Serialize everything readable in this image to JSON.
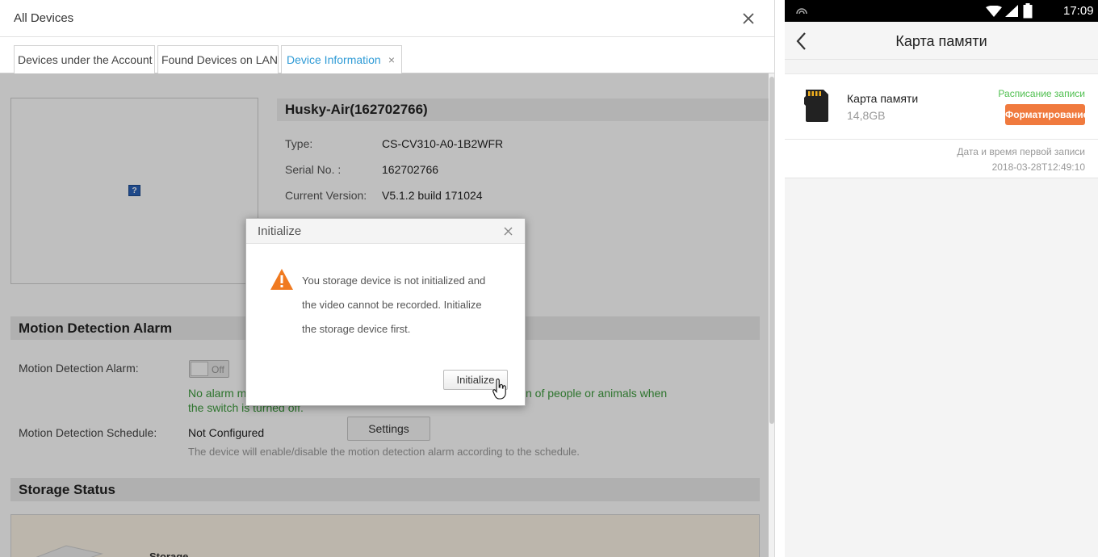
{
  "window": {
    "title": "All Devices",
    "tabs": [
      {
        "label": "Devices under the Account"
      },
      {
        "label": "Found Devices on LAN"
      },
      {
        "label": "Device Information",
        "close": "×"
      }
    ]
  },
  "device": {
    "name": "Husky-Air(162702766)",
    "type_label": "Type:",
    "type_value": "CS-CV310-A0-1B2WFR",
    "serial_label": "Serial No. :",
    "serial_value": "162702766",
    "version_label": "Current Version:",
    "version_value": "V5.1.2 build 171024",
    "image_placeholder": "?"
  },
  "motion": {
    "section_title": "Motion Detection Alarm",
    "alarm_label": "Motion Detection Alarm:",
    "toggle_state": "Off",
    "alarm_note_visible_1": "No alarm m",
    "alarm_note_visible_2": "n of people or animals when",
    "alarm_note_visible_3": "the switch is turned off.",
    "schedule_label": "Motion Detection Schedule:",
    "schedule_value": "Not Configured",
    "settings_button": "Settings",
    "schedule_hint": "The device will enable/disable the motion detection alarm according to the schedule."
  },
  "storage": {
    "section_title": "Storage Status",
    "item_label": "Storage"
  },
  "dialog": {
    "title": "Initialize",
    "close": "×",
    "message_line1": "You storage device is not initialized and",
    "message_line2": "the video cannot be recorded. Initialize",
    "message_line3": "the storage device first.",
    "button": "Initialize"
  },
  "phone": {
    "time": "17:09",
    "title": "Карта памяти",
    "card_name": "Карта памяти",
    "card_size": "14,8GB",
    "schedule_link": "Расписание записи",
    "format_button": "Форматирование",
    "first_record_label": "Дата и время первой записи",
    "first_record_value": "2018-03-28T12:49:10"
  },
  "colors": {
    "accent_blue": "#2f9bd6",
    "green_text": "#3c9b3c",
    "warning_orange": "#f07a20",
    "format_orange": "#f07a3e",
    "schedule_green": "#4fbf4f"
  },
  "icons": [
    "close-icon",
    "question-icon",
    "warning-icon",
    "hand-cursor-icon",
    "wifi-icon",
    "signal-icon",
    "battery-icon",
    "back-arrow-icon",
    "sd-card-icon"
  ]
}
